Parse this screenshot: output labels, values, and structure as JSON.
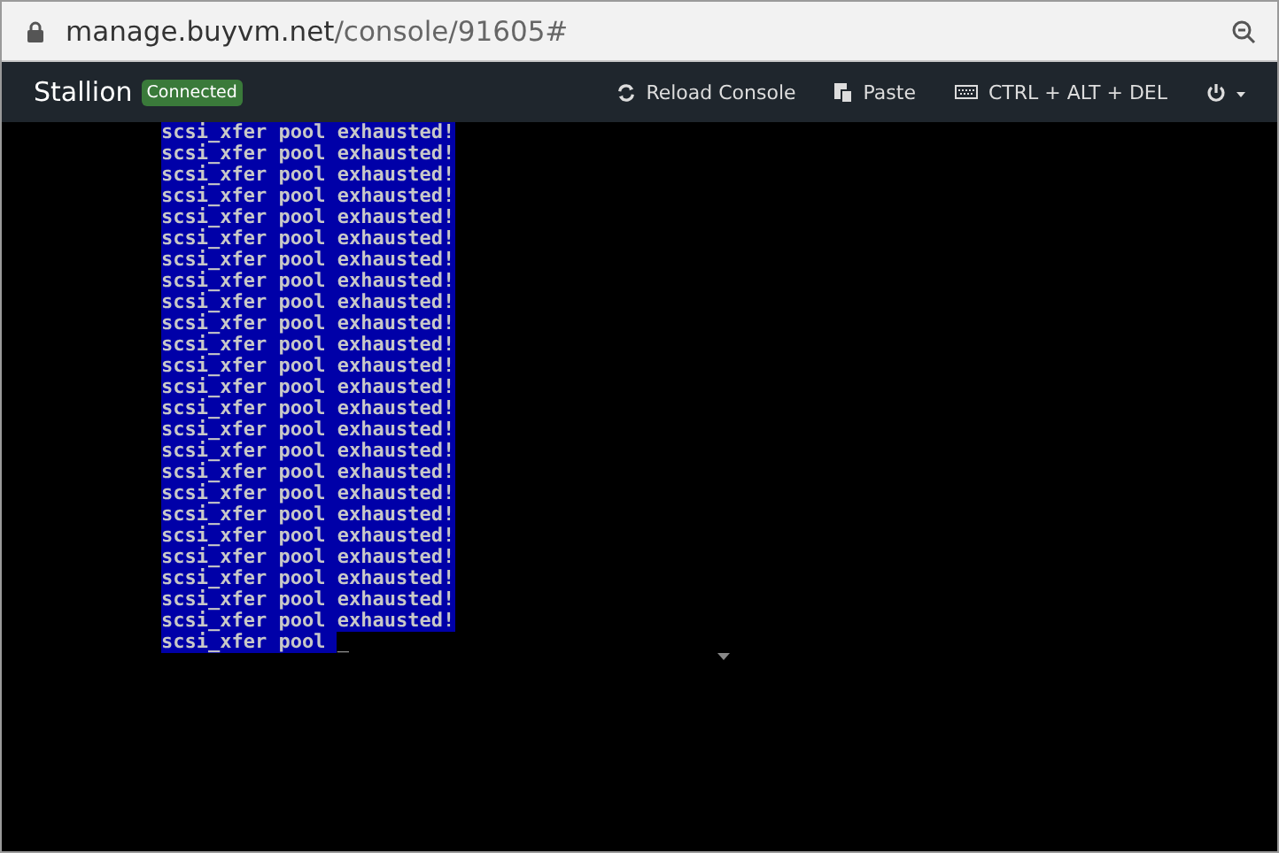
{
  "address_bar": {
    "host": "manage.buyvm.net",
    "path": "/console/91605#"
  },
  "navbar": {
    "title": "Stallion",
    "status_badge": "Connected",
    "actions": [
      {
        "kind": "reload",
        "label": "Reload Console"
      },
      {
        "kind": "paste",
        "label": "Paste"
      },
      {
        "kind": "keyboard",
        "label": "CTRL + ALT + DEL"
      },
      {
        "kind": "power"
      }
    ]
  },
  "console": {
    "lines": [
      "scsi_xfer pool exhausted!",
      "scsi_xfer pool exhausted!",
      "scsi_xfer pool exhausted!",
      "scsi_xfer pool exhausted!",
      "scsi_xfer pool exhausted!",
      "scsi_xfer pool exhausted!",
      "scsi_xfer pool exhausted!",
      "scsi_xfer pool exhausted!",
      "scsi_xfer pool exhausted!",
      "scsi_xfer pool exhausted!",
      "scsi_xfer pool exhausted!",
      "scsi_xfer pool exhausted!",
      "scsi_xfer pool exhausted!",
      "scsi_xfer pool exhausted!",
      "scsi_xfer pool exhausted!",
      "scsi_xfer pool exhausted!",
      "scsi_xfer pool exhausted!",
      "scsi_xfer pool exhausted!",
      "scsi_xfer pool exhausted!",
      "scsi_xfer pool exhausted!",
      "scsi_xfer pool exhausted!",
      "scsi_xfer pool exhausted!",
      "scsi_xfer pool exhausted!",
      "scsi_xfer pool exhausted!",
      "scsi_xfer pool "
    ],
    "cursor": "_"
  }
}
